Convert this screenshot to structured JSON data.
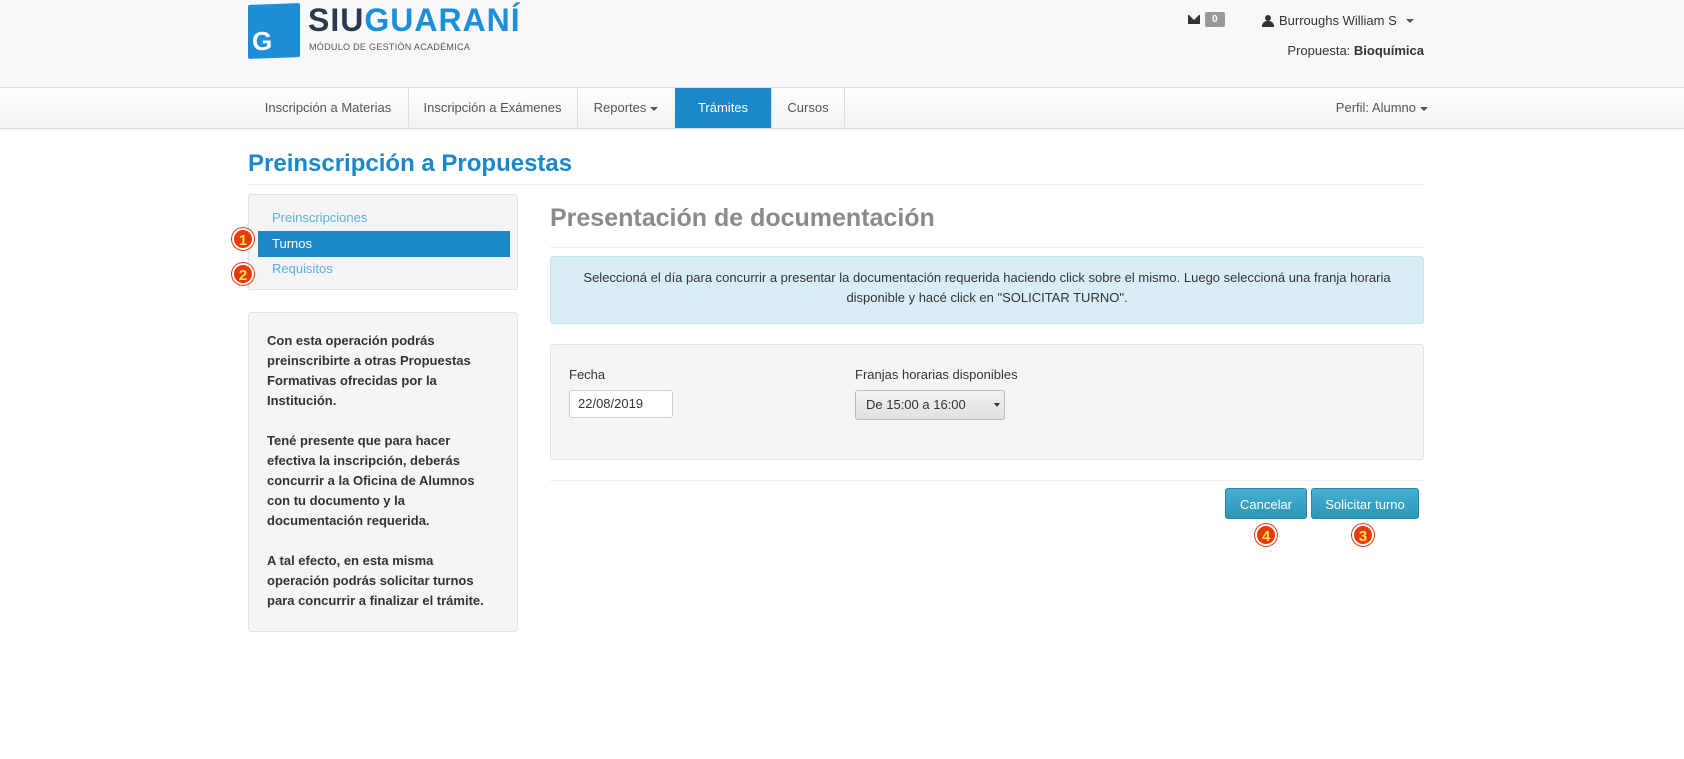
{
  "header": {
    "logo": {
      "siu": "SIU",
      "guarani": "GUARANÍ",
      "subtitle": "MÓDULO DE GESTIÓN ACADÉMICA",
      "badge_letter": "G"
    },
    "messages_count": "0",
    "user_name": "Burroughs William S",
    "propuesta_label": "Propuesta:",
    "propuesta_value": "Bioquímica"
  },
  "nav": {
    "items": [
      {
        "label": "Inscripción a Materias"
      },
      {
        "label": "Inscripción a Exámenes"
      },
      {
        "label": "Reportes"
      },
      {
        "label": "Trámites"
      },
      {
        "label": "Cursos"
      }
    ],
    "active": "Trámites",
    "profile": "Perfil: Alumno"
  },
  "page_title": "Preinscripción a Propuestas",
  "sidebar": {
    "items": [
      {
        "label": "Preinscripciones"
      },
      {
        "label": "Turnos"
      },
      {
        "label": "Requisitos"
      }
    ],
    "active": "Turnos"
  },
  "info": {
    "p1": "Con esta operación podrás preinscribirte a otras Propuestas Formativas ofrecidas por la Institución.",
    "p2": "Tené presente que para hacer efectiva la inscripción, deberás concurrir a la Oficina de Alumnos con tu documento y la documentación requerida.",
    "p3": "A tal efecto, en esta misma operación podrás solicitar turnos para concurrir a finalizar el trámite."
  },
  "main": {
    "title": "Presentación de documentación",
    "alert": "Seleccioná el día para concurrir a presentar la documentación requerida haciendo click sobre el mismo. Luego seleccioná una franja horaria disponible y hacé click en \"SOLICITAR TURNO\".",
    "fecha_label": "Fecha",
    "fecha_value": "22/08/2019",
    "franjas_label": "Franjas horarias disponibles",
    "franja_selected": "De 15:00 a 16:00",
    "cancel_label": "Cancelar",
    "submit_label": "Solicitar turno"
  },
  "markers": [
    "1",
    "2",
    "3",
    "4"
  ],
  "colors": {
    "primary": "#1a88c9",
    "marker": "#e83a0c",
    "marker_text": "#ffe24a",
    "button": "#2f96b4"
  }
}
